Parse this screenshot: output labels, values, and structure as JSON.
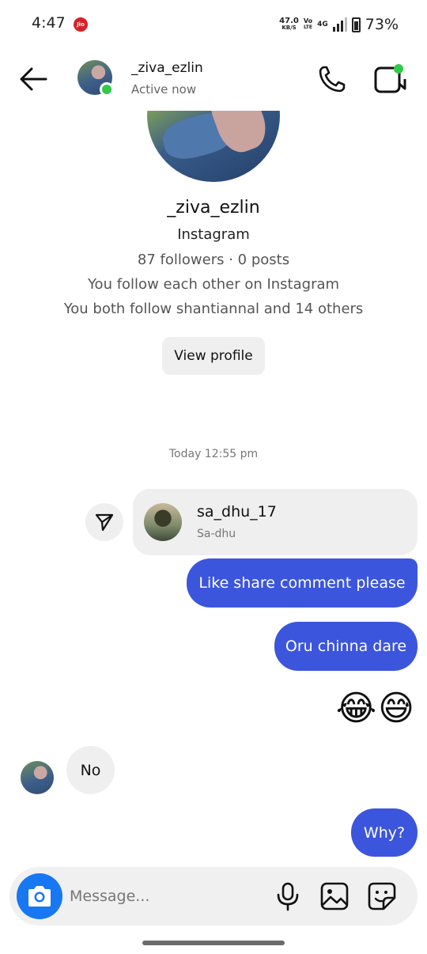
{
  "status_bar": {
    "time": "4:47",
    "carrier_badge": "Jio",
    "speed_value": "47.0",
    "speed_unit": "KB/S",
    "volte_top": "Vo",
    "volte_bottom": "LTE",
    "network": "4G",
    "battery": "73%"
  },
  "header": {
    "username": "_ziva_ezlin",
    "status": "Active now",
    "icons": {
      "back": "arrow-left-icon",
      "call": "phone-icon",
      "video": "video-camera-icon"
    },
    "online_color": "#31c94a"
  },
  "profile": {
    "username": "_ziva_ezlin",
    "platform": "Instagram",
    "stats": "87 followers · 0 posts",
    "mutual_follow": "You follow each other on Instagram",
    "mutual_followers": "You both follow shantiannal and 14 others",
    "view_profile_label": "View profile"
  },
  "chat": {
    "timestamp": "Today 12:55 pm",
    "shared_profile": {
      "username": "sa_dhu_17",
      "display_name": "Sa-dhu"
    },
    "messages": [
      {
        "from": "me",
        "text": "Like share comment please"
      },
      {
        "from": "me",
        "text": "Oru chinna dare"
      },
      {
        "from": "me",
        "text": "😂😅"
      },
      {
        "from": "them",
        "text": "No"
      },
      {
        "from": "me",
        "text": "Why?"
      }
    ],
    "sent_color": "#3c55dd",
    "received_color": "#efefef"
  },
  "composer": {
    "placeholder": "Message...",
    "icons": {
      "camera": "camera-icon",
      "mic": "microphone-icon",
      "gallery": "image-icon",
      "sticker": "sticker-icon"
    },
    "camera_color": "#1877f2"
  }
}
